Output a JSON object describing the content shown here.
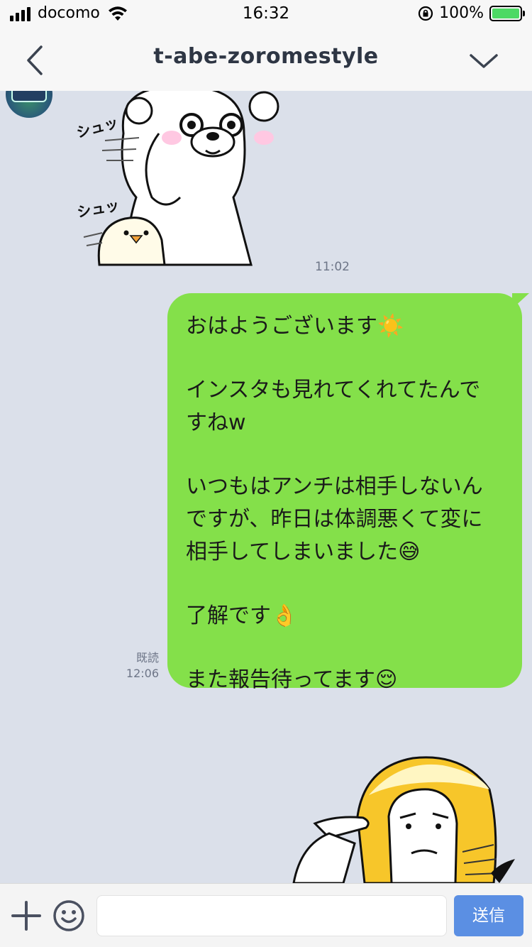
{
  "status": {
    "carrier": "docomo",
    "time": "16:32",
    "battery": "100%",
    "icons": [
      "signal-icon",
      "wifi-icon",
      "rotation-lock-icon",
      "battery-icon"
    ]
  },
  "nav": {
    "title": "t-abe-zoromestyle",
    "icons": [
      "back-chevron-icon",
      "chevron-down-icon"
    ]
  },
  "messages": {
    "incoming": {
      "sticker_text_1": "シュッ",
      "sticker_text_2": "シュッ",
      "time": "11:02"
    },
    "outgoing": {
      "lines": [
        "おはようございます☀️",
        "",
        "インスタも見れてくれてたんで",
        "すねw",
        "",
        "いつもはアンチは相手しないん",
        "ですが、昨日は体調悪くて変に",
        "相手してしまいました😅",
        "",
        "了解です👌",
        "",
        "また報告待ってます😌"
      ],
      "read_label": "既読",
      "time": "12:06"
    }
  },
  "input": {
    "send_label": "送信",
    "value": "",
    "placeholder": ""
  },
  "colors": {
    "outgoing_bubble": "#84e04a",
    "chat_background": "#dbe0ea",
    "send_button": "#5b8fe3"
  }
}
